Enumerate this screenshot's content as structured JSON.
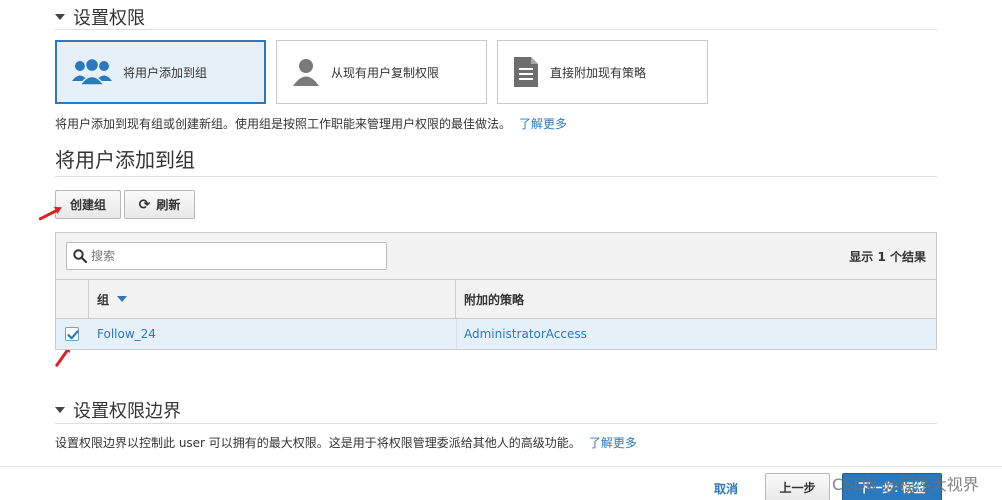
{
  "permissions_section": {
    "title": "设置权限",
    "options": [
      {
        "label": "将用户添加到组",
        "icon": "group-icon",
        "selected": true
      },
      {
        "label": "从现有用户复制权限",
        "icon": "user-icon",
        "selected": false
      },
      {
        "label": "直接附加现有策略",
        "icon": "document-icon",
        "selected": false
      }
    ],
    "description": "将用户添加到现有组或创建新组。使用组是按照工作职能来管理用户权限的最佳做法。",
    "learn_more": "了解更多"
  },
  "add_to_group": {
    "title": "将用户添加到组",
    "create_group_label": "创建组",
    "refresh_label": "刷新",
    "search_placeholder": "搜索",
    "result_count": "显示 1 个结果",
    "columns": {
      "group": "组",
      "policies": "附加的策略"
    },
    "rows": [
      {
        "group": "Follow_24",
        "policy": "AdministratorAccess",
        "checked": true
      }
    ]
  },
  "boundary_section": {
    "title": "设置权限边界",
    "description": "设置权限边界以控制此 user 可以拥有的最大权限。这是用于将权限管理委派给其他人的高级功能。",
    "learn_more": "了解更多"
  },
  "footer": {
    "cancel_label": "取消",
    "prev_label": "上一步",
    "next_label": "下一步: 标签"
  },
  "watermark": "CSDN @程序大视界",
  "colors": {
    "accent": "#2a79be",
    "selected_bg": "#e6f0f9",
    "annotation_arrow": "#e02020"
  }
}
